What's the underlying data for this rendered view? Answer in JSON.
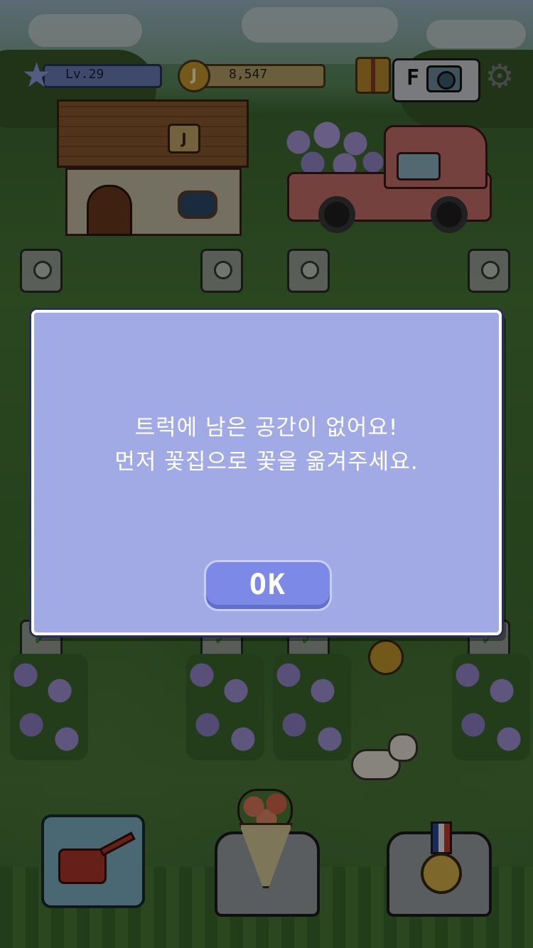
{
  "hud": {
    "level_label": "Lv.29",
    "coin_symbol": "J",
    "coin_amount": "8,547",
    "camera_badge": "F",
    "icons": [
      "star-icon",
      "coin-icon",
      "gift-icon",
      "camera-icon",
      "gear-icon"
    ]
  },
  "house": {
    "sign_label": "J"
  },
  "dialog": {
    "line1": "트럭에 남은 공간이 없어요!",
    "line2": "먼저 꽃집으로 꽃을 옮겨주세요.",
    "ok_label": "OK"
  },
  "bottom_bar": {
    "buttons": [
      "watering-can",
      "bouquet",
      "medal"
    ]
  },
  "colors": {
    "dialog_bg": "#a2aae6",
    "dialog_border": "#ffffff",
    "ok_button": "#7c89e6",
    "overlay": "rgba(0,0,0,0.42)"
  }
}
